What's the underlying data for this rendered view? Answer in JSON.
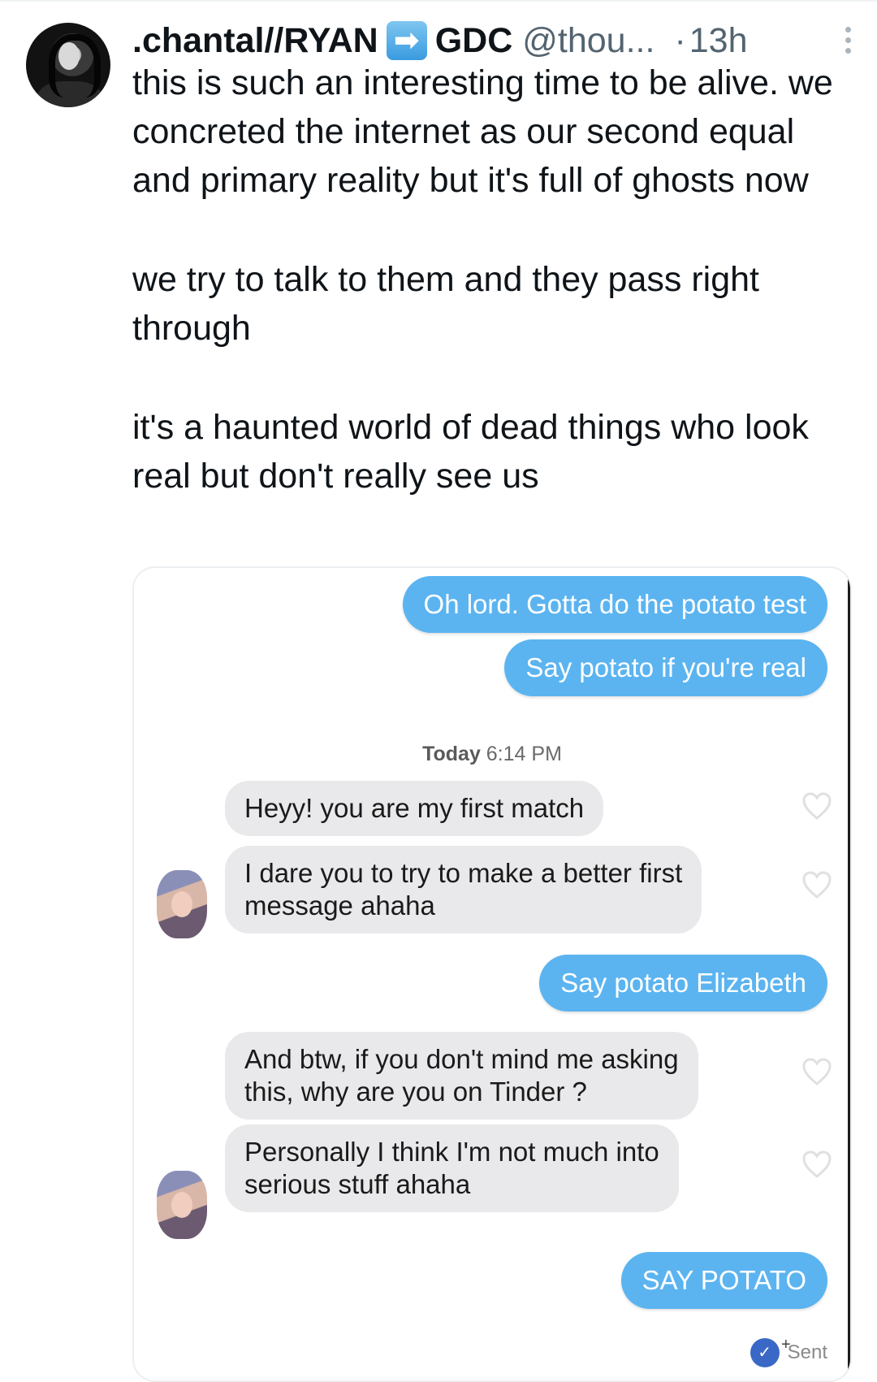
{
  "tweet": {
    "display_name_part1": ".chantal//RYAN",
    "arrow_emoji": "➡",
    "display_name_part2": "GDC",
    "handle": "@thou...",
    "separator": "·",
    "time": "13h",
    "text_lines": [
      "this is such an interesting time to be alive. we concreted the internet as our second equal and primary reality but it's full of ghosts now",
      "we try to talk to them and they pass right through",
      "it's a haunted world of dead things who look real but don't really see us"
    ]
  },
  "chat": {
    "sent1": "Oh lord. Gotta do the potato test",
    "sent2": "Say potato if you're real",
    "timestamp_day": "Today",
    "timestamp_time": "6:14 PM",
    "recv1": "Heyy! you are my first match",
    "recv2_line1": "I dare you to try to make a better first",
    "recv2_line2": "message ahaha",
    "sent3": "Say potato Elizabeth",
    "recv3_line1": "And btw, if you don't mind me asking",
    "recv3_line2": "this, why are you on Tinder ?",
    "recv4_line1": "Personally I think I'm not much into",
    "recv4_line2": "serious stuff ahaha",
    "sent4": "SAY POTATO",
    "status": "Sent"
  },
  "colors": {
    "sent_bubble": "#5bb4f0",
    "recv_bubble": "#e9e9eb",
    "secondary_text": "#536471"
  }
}
